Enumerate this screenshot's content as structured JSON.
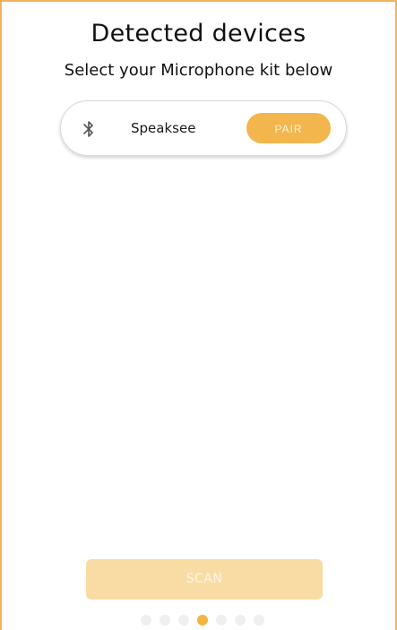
{
  "header": {
    "title": "Detected devices",
    "subtitle": "Select your Microphone kit below"
  },
  "devices": [
    {
      "name": "Speaksee",
      "icon": "bluetooth-icon",
      "action_label": "PAIR"
    }
  ],
  "footer": {
    "scan_label": "SCAN",
    "pagination": {
      "total": 7,
      "current": 4
    }
  },
  "colors": {
    "accent": "#f3b64c",
    "accent_light": "#f8dca4",
    "frame_border": "#f0b55a",
    "dot_inactive": "#efefef"
  }
}
